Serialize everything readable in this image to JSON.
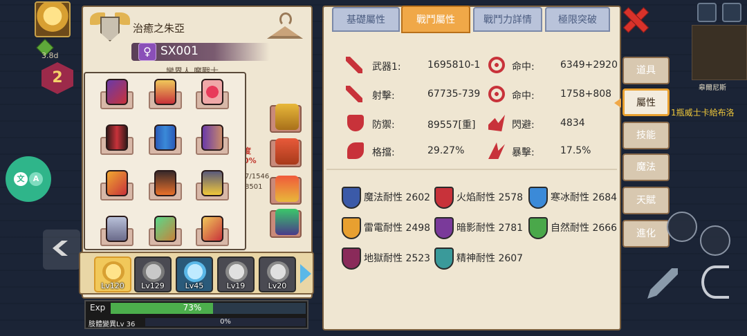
{
  "hud": {
    "timer": "3.8d",
    "level": "2"
  },
  "translate": {
    "zh": "文",
    "en": "A"
  },
  "character": {
    "title": "治癒之朱亞",
    "id": "SX001",
    "subtitle": "鑾界人 魔戰士",
    "partial_a": "度\n0%",
    "partial_b": "7/1546\n8501"
  },
  "party": [
    {
      "level": "Lv120"
    },
    {
      "level": "Lv129"
    },
    {
      "level": "Lv45"
    },
    {
      "level": "Lv19"
    },
    {
      "level": "Lv20"
    }
  ],
  "exp": {
    "label": "Exp",
    "percent_text": "73%",
    "percent": 73
  },
  "mutation": {
    "label": "肢體變異Lv 36",
    "percent_text": "0%"
  },
  "tabs": [
    {
      "label": "基礎屬性",
      "active": false
    },
    {
      "label": "戰鬥屬性",
      "active": true
    },
    {
      "label": "戰鬥力詳情",
      "active": false
    },
    {
      "label": "極限突破",
      "active": false
    }
  ],
  "combat_stats": [
    {
      "icon": "sword-icon",
      "label": "武器1:",
      "value": "1695810-1",
      "icon2": "target-icon",
      "label2": "命中:",
      "value2": "6349+2920"
    },
    {
      "icon": "sword-icon",
      "label": "射擊:",
      "value": "67735-739",
      "icon2": "target-icon",
      "label2": "命中:",
      "value2": "1758+808"
    },
    {
      "icon": "shield-icon",
      "label": "防禦:",
      "value": "89557[重]",
      "icon2": "dodge-icon",
      "label2": "閃避:",
      "value2": "4834"
    },
    {
      "icon": "block-icon",
      "label": "格擋:",
      "value": "29.27%",
      "icon2": "crit-icon",
      "label2": "暴擊:",
      "value2": "17.5%"
    }
  ],
  "resistances": [
    {
      "label": "魔法耐性 2602",
      "color": "#3b5aa8"
    },
    {
      "label": "火焰耐性 2578",
      "color": "#c8323a"
    },
    {
      "label": "寒冰耐性 2684",
      "color": "#3b8ad8"
    },
    {
      "label": "雷電耐性 2498",
      "color": "#e8a030"
    },
    {
      "label": "暗影耐性 2781",
      "color": "#7a3a9a"
    },
    {
      "label": "自然耐性 2666",
      "color": "#4aa84a"
    },
    {
      "label": "地獄耐性 2523",
      "color": "#8a2a5a"
    },
    {
      "label": "精神耐性 2607",
      "color": "#3a9a9a"
    }
  ],
  "side_menu": [
    {
      "label": "道具",
      "active": false
    },
    {
      "label": "屬性",
      "active": true
    },
    {
      "label": "技能",
      "active": false
    },
    {
      "label": "魔法",
      "active": false
    },
    {
      "label": "天賦",
      "active": false
    },
    {
      "label": "進化",
      "active": false
    }
  ],
  "map": {
    "npc_label": "皋爾尼斯",
    "quest": "1瓶威士卡給布洛"
  },
  "colors": {
    "panel": "#efe6d2",
    "tab_active": "#f0a848",
    "tab_inactive": "#b9c3da",
    "exp_fill": "#4cae4c",
    "close": "#d8322a"
  }
}
